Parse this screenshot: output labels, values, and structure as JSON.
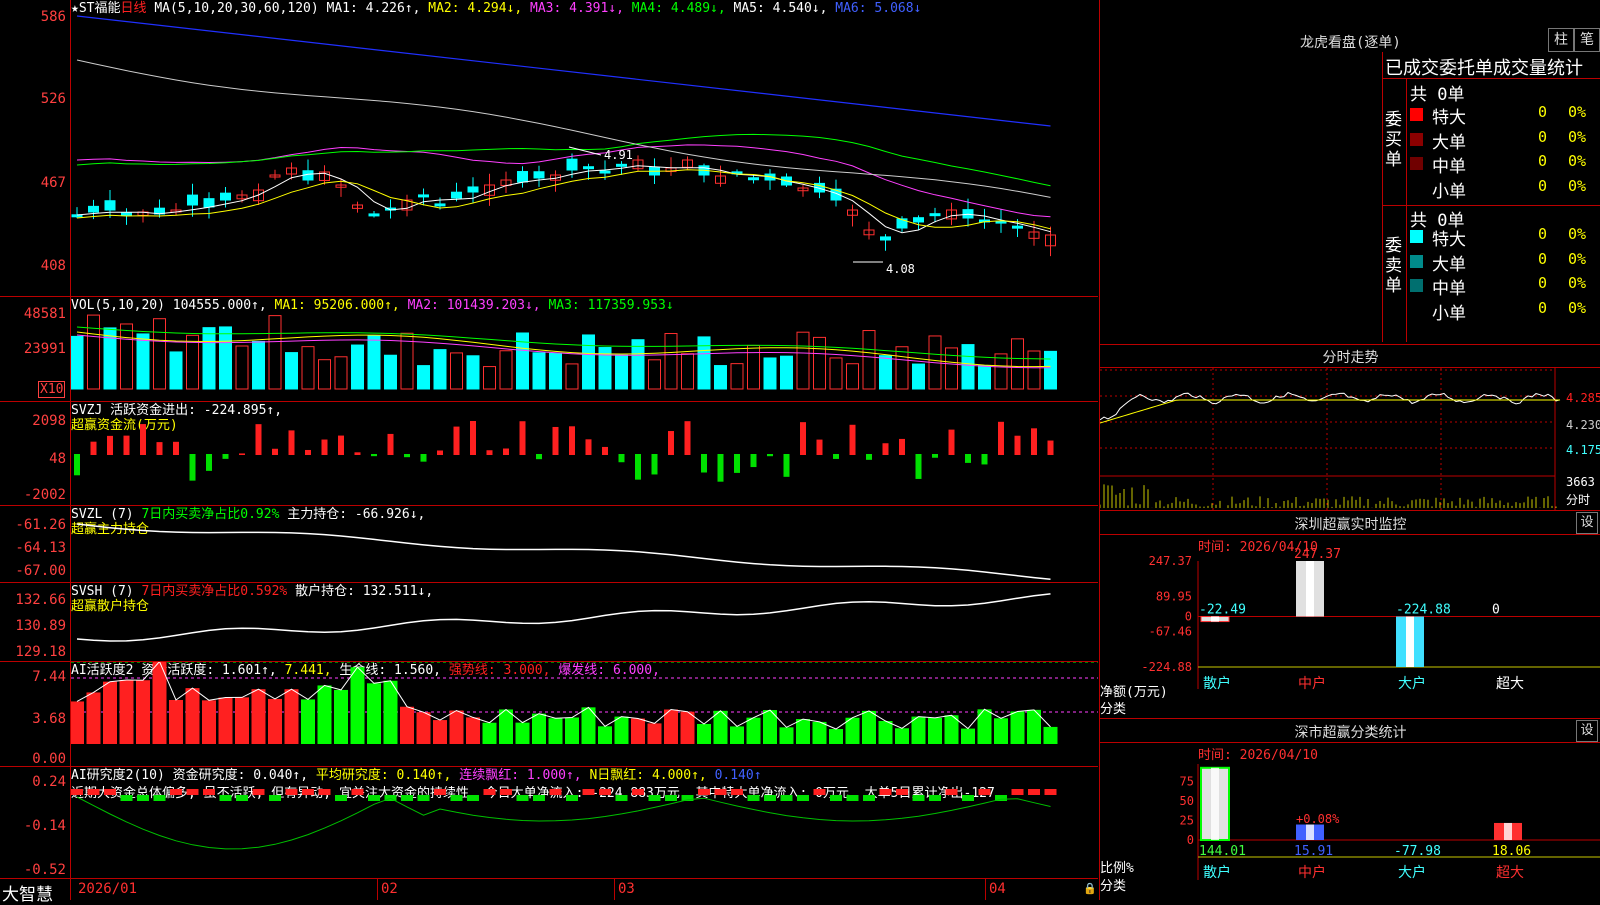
{
  "main": {
    "title_star": "★",
    "stock": "ST福能",
    "period": "日线",
    "ma_label": "MA(5,10,20,30,60,120)",
    "ma1": "MA1: 4.226↑,",
    "ma2": "MA2: 4.294↓,",
    "ma3": "MA3: 4.391↓,",
    "ma4": "MA4: 4.489↓,",
    "ma5": "MA5: 4.540↓,",
    "ma6": "MA6: 5.068↓",
    "yticks": [
      "586",
      "526",
      "467",
      "408"
    ],
    "high_label": "4.91",
    "low_label": "4.08"
  },
  "vol": {
    "label": "VOL(5,10,20)",
    "value": "104555.000↑,",
    "ma1": "MA1: 95206.000↑,",
    "ma2": "MA2: 101439.203↓,",
    "ma3": "MA3: 117359.953↓",
    "yticks": [
      "48581",
      "23991"
    ],
    "unit": "X10"
  },
  "svzj": {
    "label": "SVZJ",
    "text": "活跃资金进出: -224.895↑,",
    "sub": "超赢资金流(万元)",
    "yticks": [
      "2098",
      "48",
      "-2002"
    ]
  },
  "svzl": {
    "label": "SVZL (7)",
    "pct": "7日内买卖净占比0.92%",
    "main": "主力持仓: -66.926↓,",
    "sub": "超赢主力持仓",
    "yticks": [
      "-61.26",
      "-64.13",
      "-67.00"
    ]
  },
  "svsh": {
    "label": "SVSH (7)",
    "pct": "7日内买卖净占比0.592%",
    "main": "散户持仓: 132.511↓,",
    "sub": "超赢散户持仓",
    "yticks": [
      "132.66",
      "130.89",
      "129.18"
    ]
  },
  "ai1": {
    "label": "AI活跃度2",
    "a": "资金活跃度: 1.601↑,",
    "b": "7.441,",
    "c": "生命线: 1.560,",
    "d": "强势线: 3.000,",
    "e": "爆发线: 6.000,",
    "yticks": [
      "7.44",
      "3.68",
      "0.00"
    ]
  },
  "ai2": {
    "label": "AI研究度2(10)",
    "a": "资金研究度: 0.040↑,",
    "b": "平均研究度: 0.140↑,",
    "c": "连续飘红: 1.000↑,",
    "d": "N日飘红: 4.000↑,",
    "e": "0.140↑",
    "note": "近期大资金总体偏多, 虽不活跃, 但有异动, 宜关注大资金的持续性, 今日大单净流入: -224.883万元, 其中特大单净流入: 0万元, 大单5日累计净出-127",
    "yticks": [
      "0.24",
      "-0.14",
      "-0.52"
    ]
  },
  "bottom": {
    "brand": "大智慧",
    "dates": [
      "2026/01",
      "02",
      "03",
      "04"
    ]
  },
  "dragon": {
    "title": "龙虎看盘(逐单)",
    "btn1": "柱",
    "btn2": "笔",
    "subtitle": "已成交委托单成交量统计",
    "buy_label": "委买单",
    "sell_label": "委卖单",
    "buy_total": "共 0单",
    "sell_total": "共 0单",
    "rows": [
      {
        "name": "特大",
        "count": "0",
        "pct": "0%"
      },
      {
        "name": "大单",
        "count": "0",
        "pct": "0%"
      },
      {
        "name": "中单",
        "count": "0",
        "pct": "0%"
      },
      {
        "name": "小单",
        "count": "0",
        "pct": "0%"
      }
    ],
    "buy_colors": [
      "#ff0000",
      "#8b0000",
      "#700000"
    ],
    "sell_colors": [
      "#00ffff",
      "#008b8b",
      "#006f6f"
    ]
  },
  "minute": {
    "title": "分时走势",
    "yticks": [
      "4.285",
      "4.230",
      "4.175"
    ],
    "vol_label": "3663",
    "vol_unit": "分时"
  },
  "monitor": {
    "title": "深圳超赢实时监控",
    "btn": "设",
    "time": "时间: 2026/04/10",
    "yticks": [
      "247.37",
      "89.95",
      "0",
      "-67.46",
      "-224.88"
    ],
    "y_label": "净额(万元)",
    "x_label": "分类",
    "cats": [
      "散户",
      "中户",
      "大户",
      "超大"
    ],
    "values": [
      -22.49,
      247.37,
      -224.88,
      0
    ],
    "value_labels": [
      "-22.49",
      "247.37",
      "-224.88",
      "0"
    ]
  },
  "classify": {
    "title": "深市超赢分类统计",
    "btn": "设",
    "time": "时间: 2026/04/10",
    "yticks": [
      "75",
      "50",
      "25",
      "0"
    ],
    "y_label": "比例%",
    "x_label": "分类",
    "cats": [
      "散户",
      "中户",
      "大户",
      "超大"
    ],
    "values": [
      144.01,
      15.91,
      -77.98,
      18.06
    ],
    "value_labels": [
      "144.01",
      "15.91",
      "-77.98",
      "18.06"
    ],
    "annot": "+0.08%"
  }
}
